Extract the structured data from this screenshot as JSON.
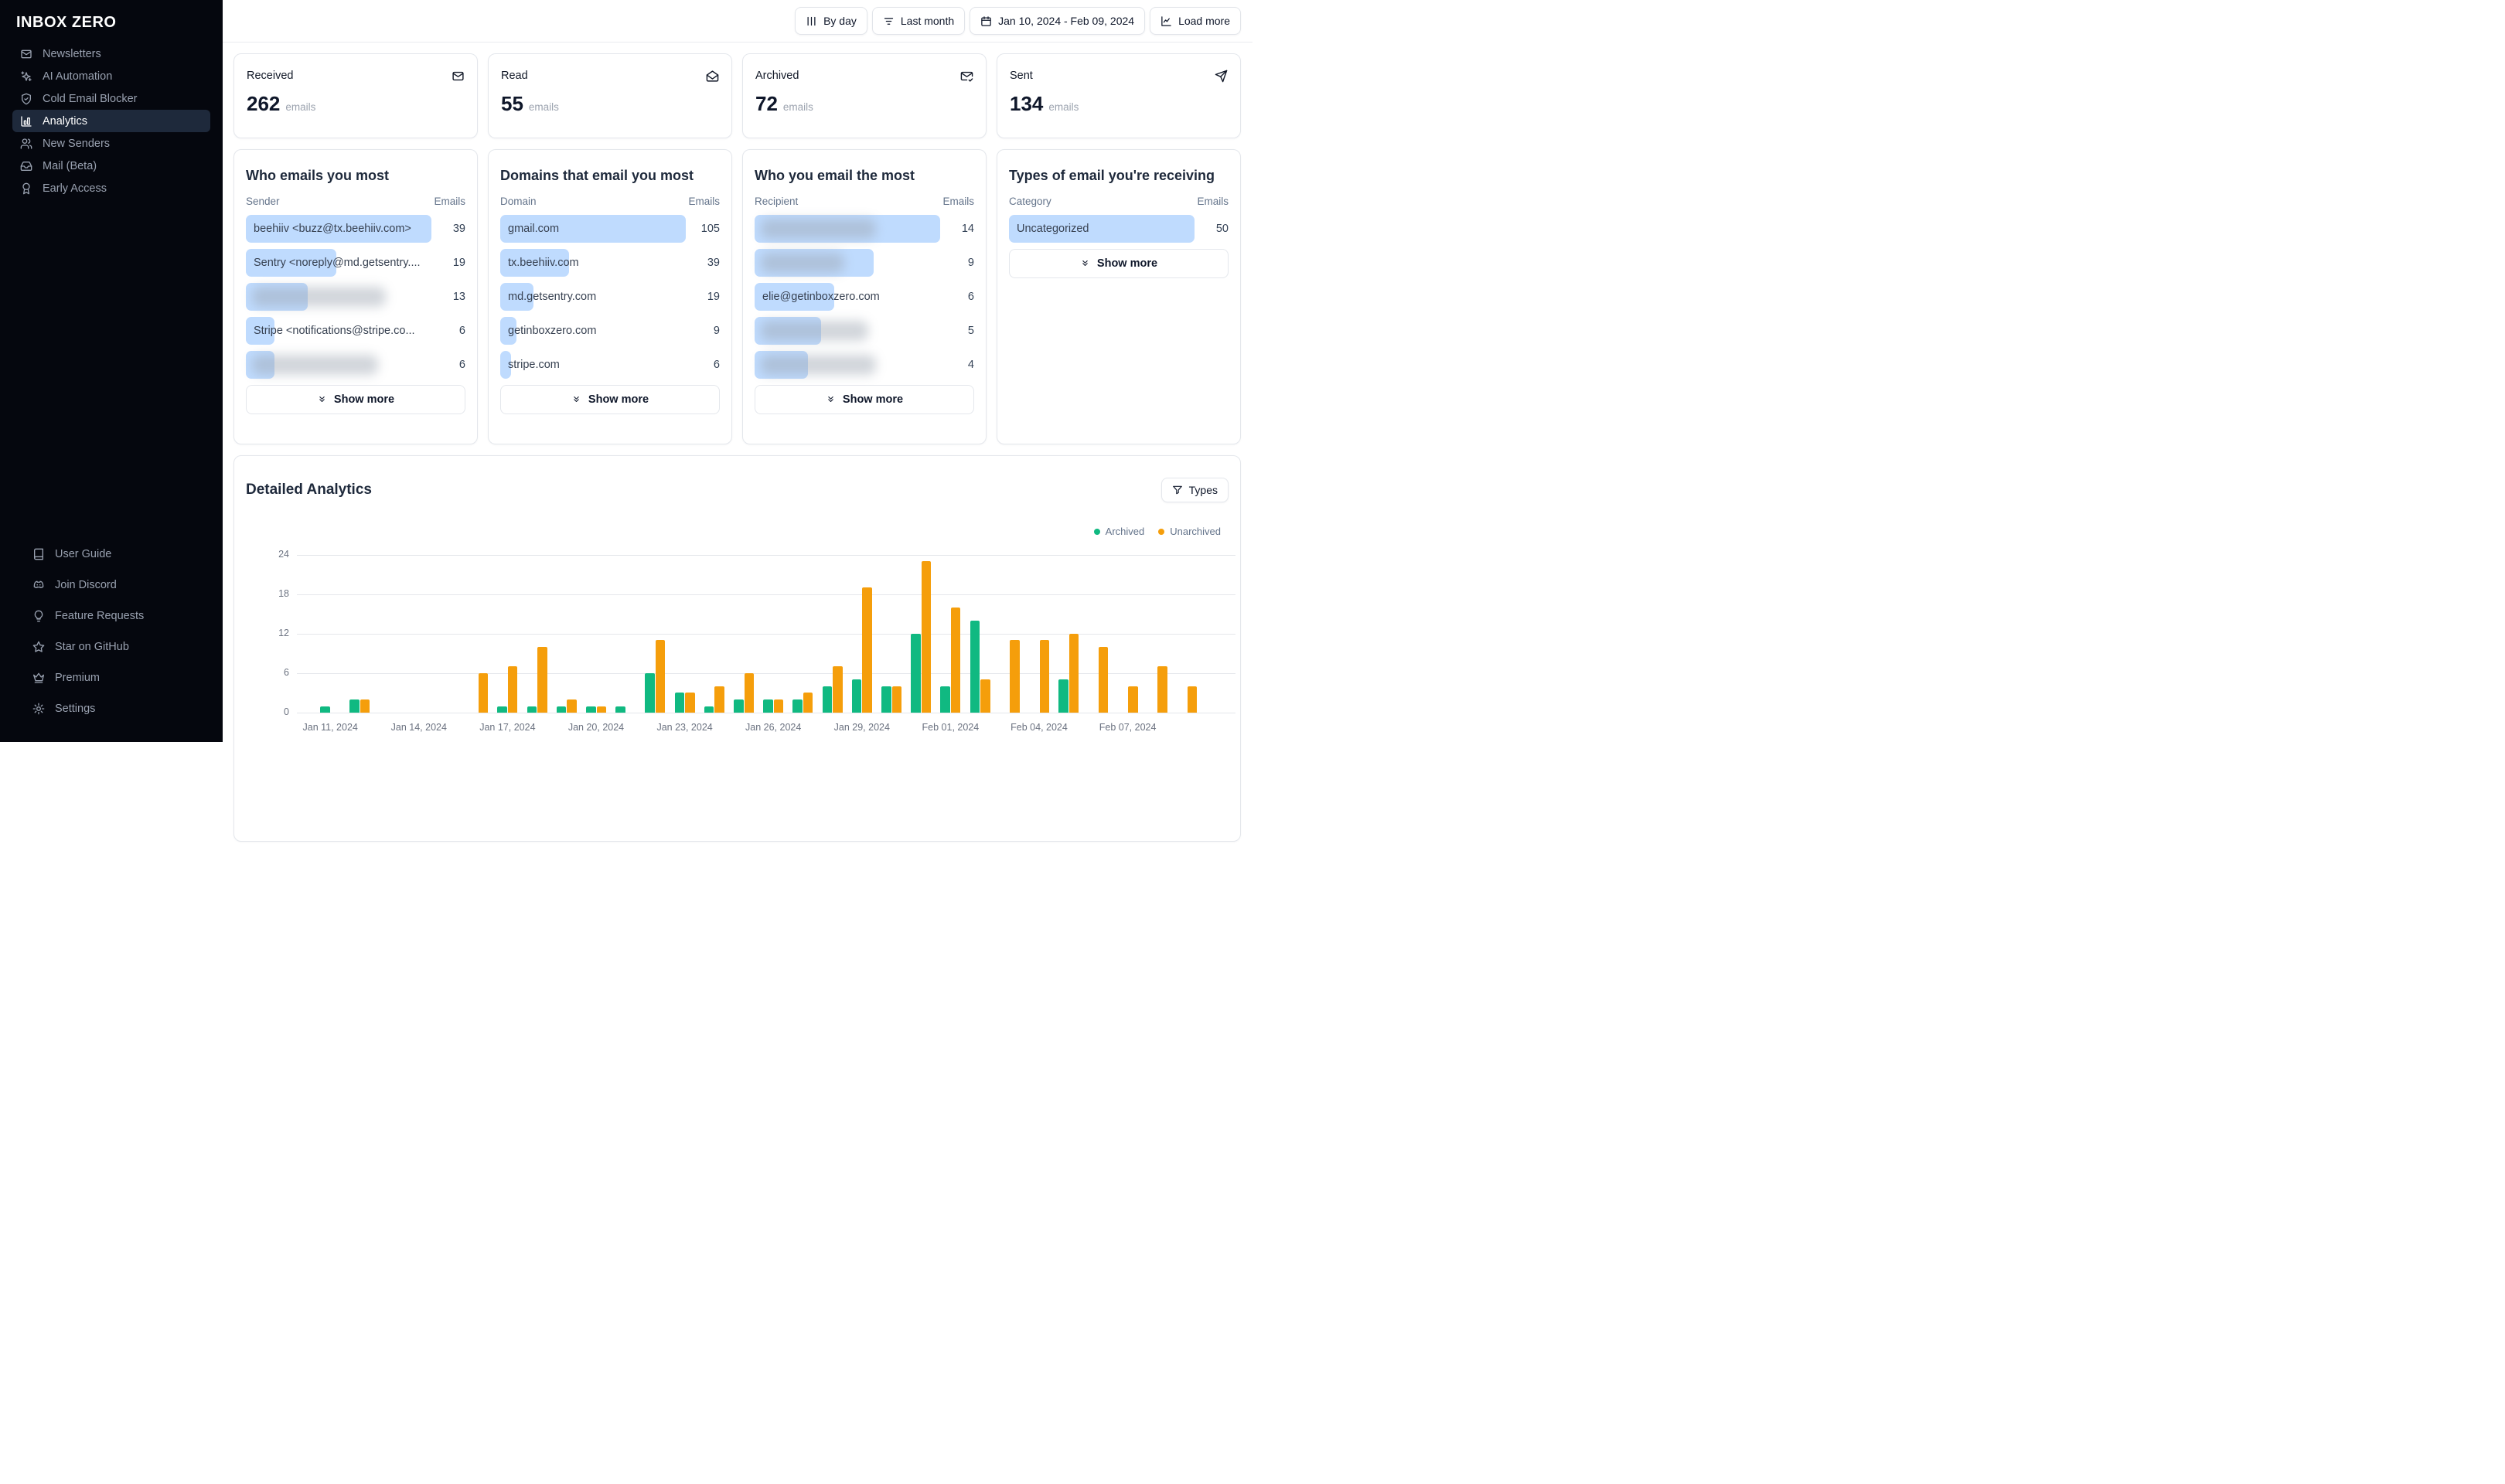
{
  "app": {
    "logo": "INBOX ZERO"
  },
  "sidebar": {
    "main_items": [
      {
        "label": "Newsletters",
        "icon": "mail",
        "active": false
      },
      {
        "label": "AI Automation",
        "icon": "sparkles",
        "active": false
      },
      {
        "label": "Cold Email Blocker",
        "icon": "shield-check",
        "active": false
      },
      {
        "label": "Analytics",
        "icon": "bar-chart",
        "active": true
      },
      {
        "label": "New Senders",
        "icon": "users",
        "active": false
      },
      {
        "label": "Mail (Beta)",
        "icon": "inbox",
        "active": false
      },
      {
        "label": "Early Access",
        "icon": "award",
        "active": false
      }
    ],
    "footer_items": [
      {
        "label": "User Guide",
        "icon": "book"
      },
      {
        "label": "Join Discord",
        "icon": "discord"
      },
      {
        "label": "Feature Requests",
        "icon": "lightbulb"
      },
      {
        "label": "Star on GitHub",
        "icon": "star"
      },
      {
        "label": "Premium",
        "icon": "crown"
      },
      {
        "label": "Settings",
        "icon": "gear"
      }
    ]
  },
  "toolbar": {
    "buttons": [
      {
        "label": "By day",
        "icon": "columns"
      },
      {
        "label": "Last month",
        "icon": "filter-lines"
      },
      {
        "label": "Jan 10, 2024 - Feb 09, 2024",
        "icon": "calendar"
      },
      {
        "label": "Load more",
        "icon": "chart-line"
      }
    ]
  },
  "stats": [
    {
      "title": "Received",
      "value": "262",
      "unit": "emails",
      "icon": "mail"
    },
    {
      "title": "Read",
      "value": "55",
      "unit": "emails",
      "icon": "mail-open"
    },
    {
      "title": "Archived",
      "value": "72",
      "unit": "emails",
      "icon": "mail-check"
    },
    {
      "title": "Sent",
      "value": "134",
      "unit": "emails",
      "icon": "send"
    }
  ],
  "highlight_bar_color": "#bfdbfe",
  "panels": [
    {
      "title": "Who emails you most",
      "columns": [
        "Sender",
        "Emails"
      ],
      "rows": [
        {
          "label": "beehiiv <buzz@tx.beehiiv.com>",
          "value": 39
        },
        {
          "label": "Sentry <noreply@md.getsentry....",
          "value": 19
        },
        {
          "label": "",
          "value": 13,
          "redacted": true,
          "blur": 0.72
        },
        {
          "label": "Stripe <notifications@stripe.co...",
          "value": 6
        },
        {
          "label": "",
          "value": 6,
          "redacted": true,
          "blur": 0.68
        }
      ],
      "show_more": "Show more"
    },
    {
      "title": "Domains that email you most",
      "columns": [
        "Domain",
        "Emails"
      ],
      "rows": [
        {
          "label": "gmail.com",
          "value": 105
        },
        {
          "label": "tx.beehiiv.com",
          "value": 39
        },
        {
          "label": "md.getsentry.com",
          "value": 19
        },
        {
          "label": "getinboxzero.com",
          "value": 9
        },
        {
          "label": "stripe.com",
          "value": 6
        }
      ],
      "show_more": "Show more"
    },
    {
      "title": "Who you email the most",
      "columns": [
        "Recipient",
        "Emails"
      ],
      "rows": [
        {
          "label": "",
          "value": 14,
          "redacted": true,
          "blur": 0.62
        },
        {
          "label": "",
          "value": 9,
          "redacted": true,
          "blur": 0.45
        },
        {
          "label": "elie@getinboxzero.com",
          "value": 6
        },
        {
          "label": "",
          "value": 5,
          "redacted": true,
          "blur": 0.58
        },
        {
          "label": "",
          "value": 4,
          "redacted": true,
          "blur": 0.62
        }
      ],
      "show_more": "Show more"
    },
    {
      "title": "Types of email you're receiving",
      "columns": [
        "Category",
        "Emails"
      ],
      "rows": [
        {
          "label": "Uncategorized",
          "value": 50
        }
      ],
      "show_more": "Show more"
    }
  ],
  "detailed": {
    "title": "Detailed Analytics",
    "filter_button": "Types",
    "legend": [
      {
        "label": "Archived",
        "color": "#10b981"
      },
      {
        "label": "Unarchived",
        "color": "#f59e0b"
      }
    ]
  },
  "chart_data": {
    "type": "bar",
    "title": "Detailed Analytics",
    "ylim": [
      0,
      24
    ],
    "yticks": [
      0,
      6,
      12,
      18,
      24
    ],
    "grid": true,
    "legend_position": "top-right",
    "categories": [
      "Jan 10, 2024",
      "Jan 11, 2024",
      "Jan 12, 2024",
      "Jan 13, 2024",
      "Jan 14, 2024",
      "Jan 15, 2024",
      "Jan 16, 2024",
      "Jan 17, 2024",
      "Jan 18, 2024",
      "Jan 19, 2024",
      "Jan 20, 2024",
      "Jan 21, 2024",
      "Jan 22, 2024",
      "Jan 23, 2024",
      "Jan 24, 2024",
      "Jan 25, 2024",
      "Jan 26, 2024",
      "Jan 27, 2024",
      "Jan 28, 2024",
      "Jan 29, 2024",
      "Jan 30, 2024",
      "Jan 31, 2024",
      "Feb 01, 2024",
      "Feb 02, 2024",
      "Feb 03, 2024",
      "Feb 04, 2024",
      "Feb 05, 2024",
      "Feb 06, 2024",
      "Feb 07, 2024",
      "Feb 08, 2024",
      "Feb 09, 2024"
    ],
    "x_tick_labels": [
      "Jan 11, 2024",
      "Jan 14, 2024",
      "Jan 17, 2024",
      "Jan 20, 2024",
      "Jan 23, 2024",
      "Jan 26, 2024",
      "Jan 29, 2024",
      "Feb 01, 2024",
      "Feb 04, 2024",
      "Feb 07, 2024"
    ],
    "series": [
      {
        "name": "Archived",
        "color": "#10b981",
        "values": [
          0,
          1,
          2,
          0,
          0,
          0,
          0,
          1,
          1,
          1,
          1,
          1,
          6,
          3,
          1,
          2,
          2,
          2,
          4,
          5,
          4,
          12,
          4,
          14,
          0,
          0,
          5,
          0,
          0,
          0,
          0
        ]
      },
      {
        "name": "Unarchived",
        "color": "#f59e0b",
        "values": [
          0,
          0,
          2,
          0,
          0,
          0,
          6,
          7,
          10,
          2,
          1,
          0,
          11,
          3,
          4,
          6,
          2,
          3,
          7,
          19,
          4,
          23,
          16,
          5,
          11,
          11,
          12,
          10,
          4,
          7,
          4
        ]
      }
    ]
  }
}
